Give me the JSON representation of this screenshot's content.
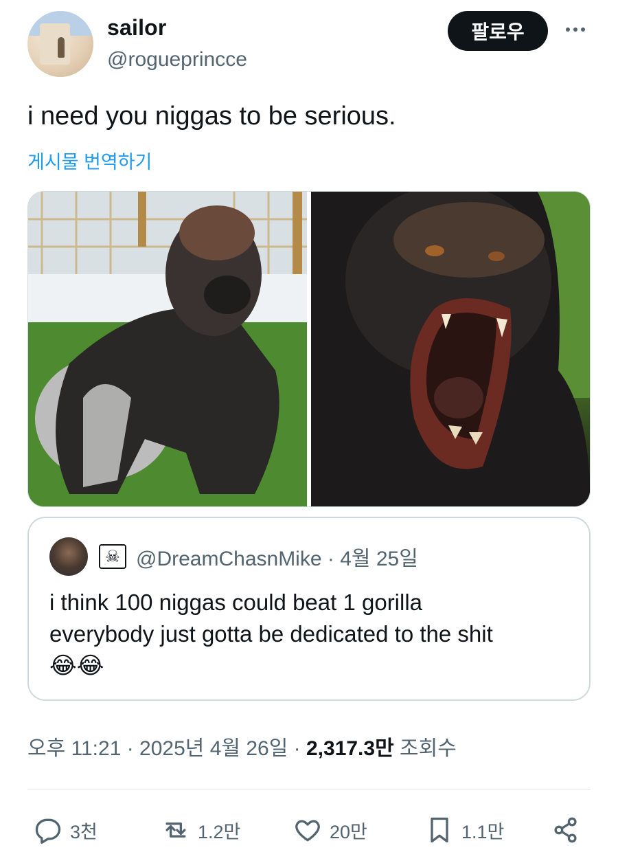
{
  "tweet": {
    "author_name": "sailor",
    "author_handle": "@rogueprincce",
    "follow_label": "팔로우",
    "text": "i need you niggas to be serious.",
    "translate_label": "게시물 번역하기",
    "timestamp": "오후 11:21 · 2025년 4월 26일",
    "views_count": "2,317.3만",
    "views_label": "조회수"
  },
  "quoted": {
    "handle": "@DreamChasnMike",
    "date": "4월 25일",
    "text_line1": "i think 100 niggas could beat 1 gorilla",
    "text_line2": "everybody just gotta be dedicated to the shit",
    "emoji": "😂😂"
  },
  "actions": {
    "reply_count": "3천",
    "retweet_count": "1.2만",
    "like_count": "20만",
    "bookmark_count": "1.1만"
  },
  "icons": [
    "more-icon",
    "reply-icon",
    "retweet-icon",
    "like-icon",
    "bookmark-icon",
    "share-icon",
    "jolly-roger-icon"
  ],
  "colors": {
    "accent": "#1d9bf0",
    "text": "#0f1419",
    "secondary": "#536471",
    "border": "#cfd9de"
  }
}
